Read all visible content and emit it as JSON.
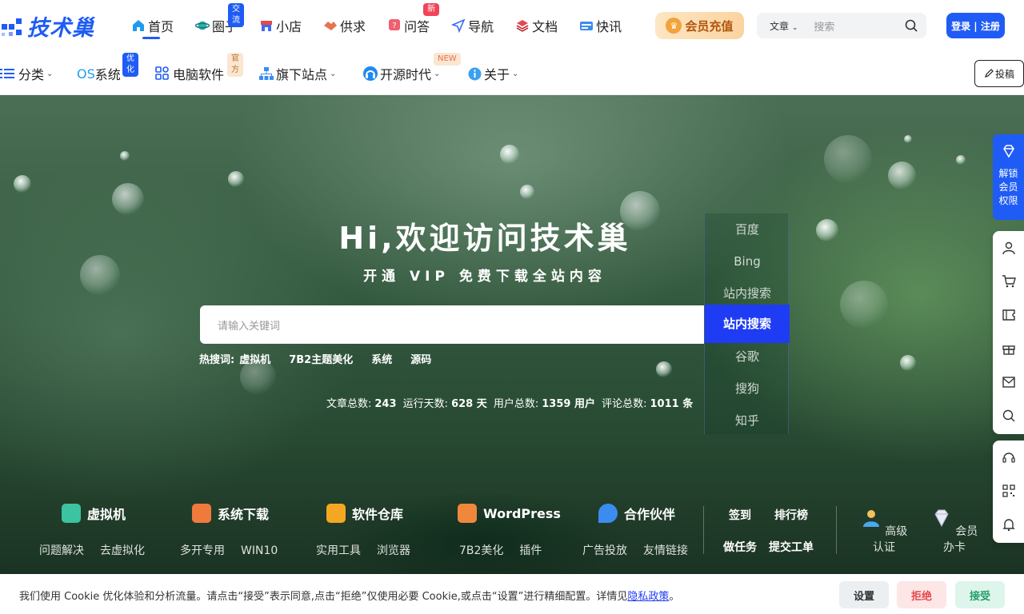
{
  "brand": {
    "logo_text": "技术巢",
    "accent": "#1f5cf5"
  },
  "nav": {
    "items": [
      {
        "label": "首页",
        "icon": "home-icon",
        "active": true
      },
      {
        "label": "圈子",
        "icon": "planet-icon",
        "badge": "交流"
      },
      {
        "label": "小店",
        "icon": "shop-icon"
      },
      {
        "label": "供求",
        "icon": "handshake-icon"
      },
      {
        "label": "问答",
        "icon": "question-icon",
        "badge": "新"
      },
      {
        "label": "导航",
        "icon": "navigation-icon"
      },
      {
        "label": "文档",
        "icon": "layers-icon"
      },
      {
        "label": "快讯",
        "icon": "news-icon"
      }
    ],
    "vip_label": "会员充值",
    "search_type": "文章",
    "search_placeholder": "搜索",
    "login_label": "登录 | 注册"
  },
  "subnav": {
    "items": [
      {
        "label": "分类",
        "icon": "list-icon"
      },
      {
        "label": "系统",
        "prefix": "OS",
        "badge": "优化"
      },
      {
        "label": "电脑软件",
        "icon": "apps-icon",
        "badge": "官方"
      },
      {
        "label": "旗下站点",
        "icon": "sitemap-icon"
      },
      {
        "label": "开源时代",
        "icon": "headset-icon",
        "badge": "NEW"
      },
      {
        "label": "关于",
        "icon": "info-icon"
      }
    ],
    "post_label": "投稿"
  },
  "hero": {
    "title": "Hi,欢迎访问技术巢",
    "subtitle": "开通 VIP 免费下载全站内容",
    "search_placeholder": "请输入关键词",
    "engines": [
      "百度",
      "Bing",
      "站内搜索",
      "站内搜索",
      "谷歌",
      "搜狗",
      "知乎"
    ],
    "selected_engine": "站内搜索",
    "hot_label": "热搜词:",
    "hot_words": [
      "虚拟机",
      "7B2主题美化",
      "系统",
      "源码"
    ],
    "stats": {
      "articles_label": "文章总数:",
      "articles": "243",
      "days_label": "运行天数:",
      "days": "628 天",
      "users_label": "用户总数:",
      "users": "1359 用户",
      "comments_label": "评论总数:",
      "comments": "1011 条"
    }
  },
  "features": [
    {
      "title": "虚拟机",
      "links": [
        "问题解决",
        "去虚拟化"
      ],
      "color": "#3cc3a0"
    },
    {
      "title": "系统下载",
      "links": [
        "多开专用",
        "WIN10"
      ],
      "color": "#f07a3c"
    },
    {
      "title": "软件仓库",
      "links": [
        "实用工具",
        "浏览器"
      ],
      "color": "#f5a623"
    },
    {
      "title": "WordPress",
      "links": [
        "7B2美化",
        "插件"
      ],
      "color": "#f0883c"
    },
    {
      "title": "合作伙伴",
      "links": [
        "广告投放",
        "友情链接"
      ],
      "color": "#3c8cf0"
    }
  ],
  "quick": {
    "checkin": "签到",
    "ranking": "排行榜",
    "tasks": "做任务",
    "ticket": "提交工单"
  },
  "certs": [
    {
      "label": "高级认证",
      "icon": "user-cert-icon"
    },
    {
      "label": "会员办卡",
      "icon": "diamond-icon"
    }
  ],
  "sidebar": {
    "vip_text_1": "解锁",
    "vip_text_2": "会员",
    "vip_text_3": "权限"
  },
  "cookie": {
    "message": "我们使用 Cookie 优化体验和分析流量。请点击“接受”表示同意,点击“拒绝”仅使用必要 Cookie,或点击“设置”进行精细配置。详情见",
    "policy_link": "隐私政策",
    "period": "。",
    "settings": "设置",
    "reject": "拒绝",
    "accept": "接受"
  }
}
